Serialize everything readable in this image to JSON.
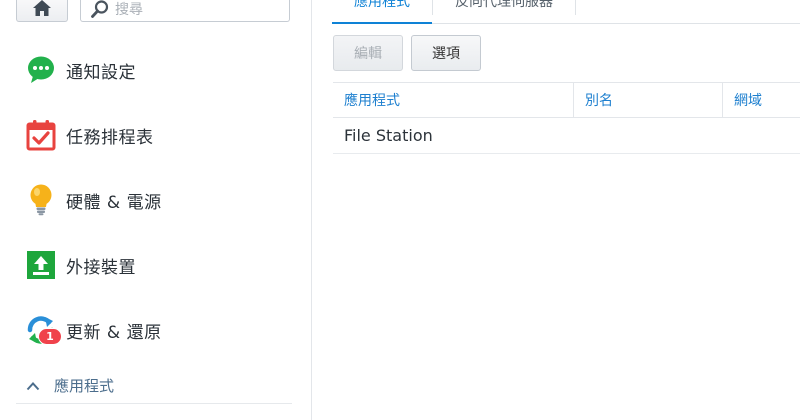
{
  "sidebar": {
    "search": {
      "placeholder": "搜尋"
    },
    "items": [
      {
        "label": "通知設定",
        "icon": "chat-bubble-icon"
      },
      {
        "label": "任務排程表",
        "icon": "calendar-check-icon"
      },
      {
        "label": "硬體 & 電源",
        "icon": "lightbulb-icon"
      },
      {
        "label": "外接裝置",
        "icon": "upload-device-icon"
      },
      {
        "label": "更新 & 還原",
        "icon": "update-restore-icon",
        "badge": "1"
      }
    ],
    "section": {
      "label": "應用程式",
      "icon": "chevron-up-icon"
    }
  },
  "main": {
    "tabs": [
      {
        "label": "應用程式",
        "active": true
      },
      {
        "label": "反向代理伺服器",
        "active": false
      }
    ],
    "toolbar": {
      "edit_label": "編輯",
      "options_label": "選項"
    },
    "grid": {
      "columns": [
        "應用程式",
        "別名",
        "網域"
      ],
      "rows": [
        [
          "File Station",
          "",
          ""
        ]
      ]
    }
  },
  "colors": {
    "accent": "#0e82d6",
    "badge": "#f0424b",
    "header_text": "#1d7fcf"
  }
}
